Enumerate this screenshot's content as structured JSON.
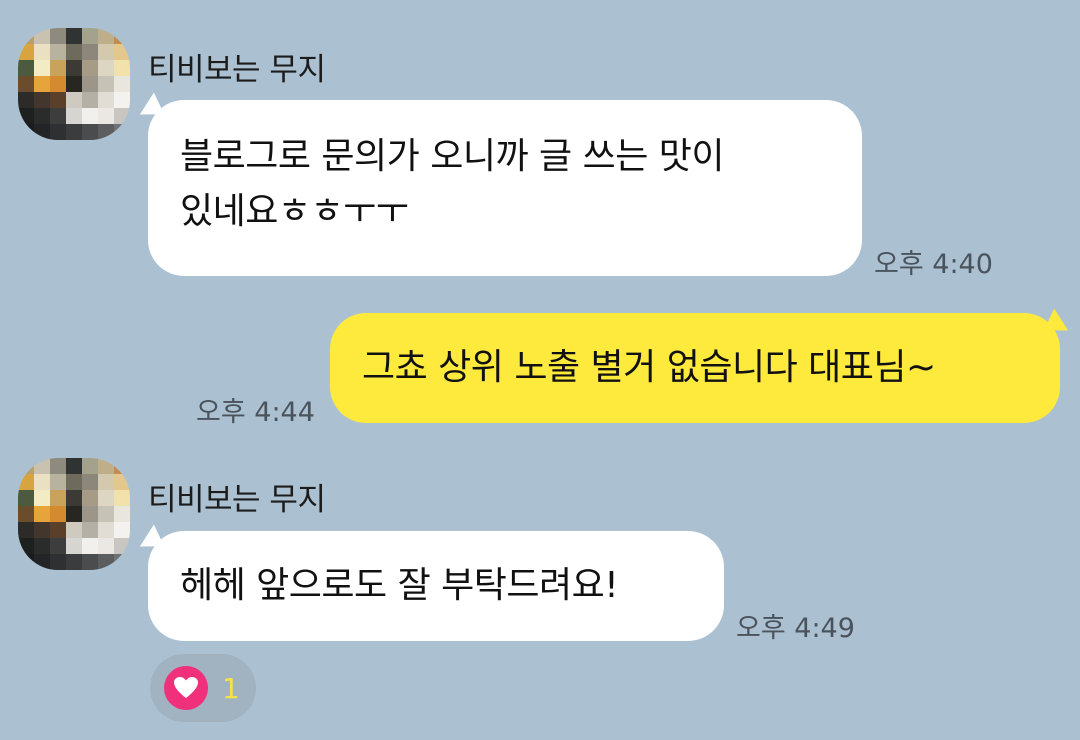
{
  "chat": {
    "messages": [
      {
        "sender": "티비보는 무지",
        "text_lines": [
          "블로그로 문의가 오니까 글 쓰는 맛이",
          "있네요ㅎㅎㅜㅜ"
        ],
        "time": "오후 4:40"
      },
      {
        "text": "그쵸 상위 노출 별거 없습니다 대표님~",
        "time": "오후 4:44"
      },
      {
        "sender": "티비보는 무지",
        "text": "헤헤 앞으로도 잘 부탁드려요!",
        "time": "오후 4:49",
        "reaction": {
          "icon": "heart-icon",
          "count": "1"
        }
      }
    ]
  },
  "colors": {
    "background": "#abc1d1",
    "incoming_bubble": "#ffffff",
    "outgoing_bubble": "#fee93d",
    "reaction_heart": "#f0307a"
  }
}
